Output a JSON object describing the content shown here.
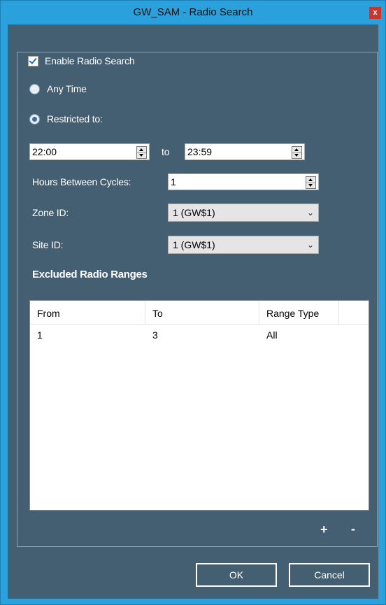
{
  "window": {
    "title": "GW_SAM - Radio Search",
    "close_glyph": "x"
  },
  "enable_radio_search": {
    "label": "Enable Radio Search",
    "checked": true
  },
  "time_options": {
    "any_time": {
      "label": "Any Time",
      "selected": false
    },
    "restricted": {
      "label": "Restricted to:",
      "selected": true
    }
  },
  "time_range": {
    "start": "22:00",
    "separator": "to",
    "end": "23:59"
  },
  "hours_between_cycles": {
    "label": "Hours Between Cycles:",
    "value": "1"
  },
  "zone": {
    "label": "Zone ID:",
    "value": "1 (GW$1)"
  },
  "site": {
    "label": "Site ID:",
    "value": "1 (GW$1)"
  },
  "excluded": {
    "title": "Excluded Radio Ranges",
    "columns": [
      "From",
      "To",
      "Range Type"
    ],
    "rows": [
      {
        "from": "1",
        "to": "3",
        "range_type": "All"
      }
    ]
  },
  "list_actions": {
    "add": "+",
    "remove": "-"
  },
  "buttons": {
    "ok": "OK",
    "cancel": "Cancel"
  },
  "colors": {
    "titlebar": "#2aa1dc",
    "client_bg": "#445f72",
    "close": "#c7372f"
  }
}
